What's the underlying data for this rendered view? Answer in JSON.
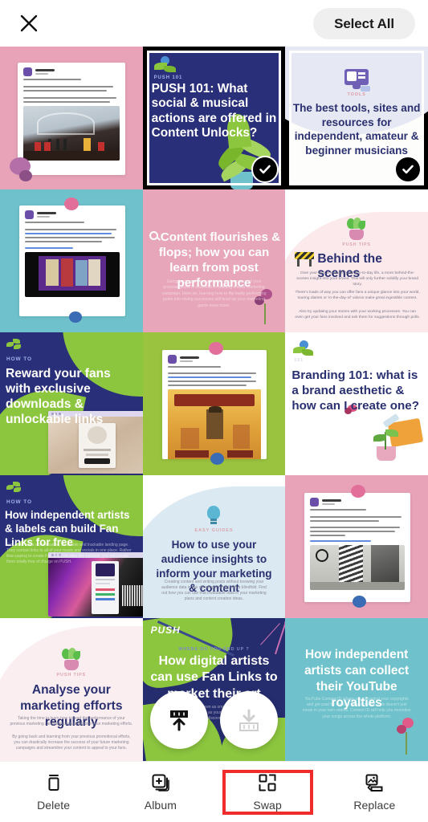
{
  "header": {
    "close_icon": "close-icon",
    "select_all_label": "Select All"
  },
  "grid": {
    "rows": 5,
    "cols": 3,
    "tiles": [
      {
        "id": "tile-1-1",
        "kind": "screenshot-post",
        "bg": "#e8a3b8",
        "selected": false,
        "post_caption": "Creative marketing idea #10",
        "post_body": "Not sure where to put on your next event on? In Beefeater gin's case, the sky's the limit - literally.",
        "post_body2": "When looking for venues, try approaching art galleries, theatres & others to make your event stand out."
      },
      {
        "id": "tile-1-2",
        "kind": "headline-card",
        "bg": "#2a2f7a",
        "selected": true,
        "eyebrow": "PUSH 101",
        "headline": "PUSH 101: What social & musical actions are offered in Content Unlocks?",
        "text_color": "#ffffff",
        "icon": "plant-sprout-icon"
      },
      {
        "id": "tile-1-3",
        "kind": "headline-card",
        "bg": "#fdfdfb",
        "selected": true,
        "eyebrow": "TOOLS",
        "headline": "The best tools, sites and resources for independent, amateur & beginner musicians",
        "text_color": "#2a3070",
        "icon": "monitor-icon"
      },
      {
        "id": "tile-2-1",
        "kind": "screenshot-post",
        "bg": "#6fc2cb",
        "selected": false,
        "post_caption": "Creative marketing idea #12",
        "post_body": "Support your fellow suppliers, brands & shops, just like @Cadbury UK have done in their 'For the love of chocolate' campaign, encouraging their customers to support their local shops as lockdowns lift.",
        "post_body2": "#forthelovechocolate"
      },
      {
        "id": "tile-2-2",
        "kind": "headline-card",
        "bg": "#e8a6bb",
        "selected": false,
        "eyebrow": "",
        "headline": "Content flourishes & flops; how you can learn from post performance",
        "body": "Going back and evaluating the performance of your previous posts is essential to building a solid marketing campaign. Here on, learning how to flip badly performing posts into raving successes will level up your marketing game even more.",
        "text_color": "#ffffff",
        "icon": "magnifier-icon"
      },
      {
        "id": "tile-2-3",
        "kind": "headline-card",
        "bg": "#fbeef0",
        "selected": false,
        "eyebrow": "PUSH TIPS",
        "headline": "Behind the scenes",
        "body": "Give your fans a look into your day-to-day life, a more behind-the-scenes insight into your brand. This will only further solidify your brand story.",
        "body2": "There's loads of way you can offer fans a unique glance into your world, touring diaries or 'in-the-day-of' videos make great ingestible content.",
        "body3": "Also try updating your stories with your working processes. You can even get your fans involved and ask them for suggestions through polls.",
        "text_color": "#2a3070",
        "icon": "potted-plant-icon"
      },
      {
        "id": "tile-3-1",
        "kind": "headline-card",
        "bg": "#2a2f7a",
        "selected": false,
        "eyebrow": "HOW TO",
        "headline": "Reward your fans with exclusive downloads & unlockable links",
        "text_color": "#ffffff",
        "icon": "leaves-icon"
      },
      {
        "id": "tile-3-2",
        "kind": "screenshot-post",
        "bg": "#9ac43f",
        "selected": false,
        "post_caption": "Creative marketing idea #7",
        "post_body": "Has your recently filled your brand's content a little dry? Look at other brands & add some ingenuity.",
        "post_body2": "How they are a calm, honest product, something both eye-catching and informative content in their customers.",
        "poster_title": "PRIOR BOYS"
      },
      {
        "id": "tile-3-3",
        "kind": "headline-card",
        "bg": "#ffffff",
        "selected": false,
        "eyebrow": "101",
        "headline": "Branding 101: what is a brand aesthetic & how can I create one?",
        "text_color": "#2a3070",
        "icon": "flower-icon"
      },
      {
        "id": "tile-4-1",
        "kind": "headline-card",
        "bg": "#2a2f7a",
        "selected": false,
        "eyebrow": "HOW TO",
        "headline": "How independent artists & labels can build Fan Links for free",
        "body": "Fan Links are a customisable, shareable and trackable landing page. They contain links to all of your music and socials in one place. Rather than paying to create Fan Links on sites like Linktree, you can create them totally free of charge on PUSH.",
        "text_color": "#ffffff",
        "icon": "leaves-icon"
      },
      {
        "id": "tile-4-2",
        "kind": "headline-card",
        "bg": "#f4f9fb",
        "selected": false,
        "eyebrow": "EASY GUIDES",
        "headline": "How to use your audience insights to inform your marketing & content",
        "body": "Creating content and writing posts without knowing your audience data is like shooting a target with a blindfold. Find out how you can use that invaluable data in your marketing plans and content creation ideas.",
        "text_color": "#2a3070",
        "icon": "lightbulb-icon"
      },
      {
        "id": "tile-4-3",
        "kind": "screenshot-post",
        "bg": "#e8a3b8",
        "selected": false,
        "post_caption": "Creative marketing idea #10",
        "post_body": "Volkswagen's campaign 'The Fun Theory' saw a set of stairs turned into a giant piano.",
        "post_body2": "Try and add a touch of fun to your marketing campaigns - it's guaranteed to get a smile from your audience.",
        "post_body3": "#marketing #pianostairs #thefuntheory"
      },
      {
        "id": "tile-5-1",
        "kind": "headline-card",
        "bg": "#ffffff",
        "selected": false,
        "eyebrow": "PUSH TIPS",
        "headline": "Analyse your marketing efforts regularly",
        "body": "Taking the time to learn how to read the performance of your previous marketing campaigns can streamline your marketing efforts.",
        "body2": "By going back and learning from your previous promotional efforts, you can drastically increase the success of your future marketing campaigns and streamline your content to appeal to your fans.",
        "text_color": "#2a3070",
        "icon": "potted-plant-icon"
      },
      {
        "id": "tile-5-2",
        "kind": "headline-card",
        "bg": "#262d6e",
        "selected": false,
        "eyebrow": "PUSH",
        "subeyebrow": "WHERE DO YOU END UP ?",
        "headline": "How digital artists can use Fan Links to market their art",
        "body": "Fan Links are also known as smart links that contain links to your art. Use them as your hub, a perfect place for fans to discover your art.",
        "text_color": "#ffffff",
        "icon": "leaves-icon"
      },
      {
        "id": "tile-5-3",
        "kind": "headline-card",
        "bg": "#6fc2cb",
        "selected": false,
        "eyebrow": "",
        "headline": "How independent artists can collect their YouTube royalties",
        "body": "YouTube Content ID allows you to control your copyrights and get paid for the use of your music. This doesn't just mean in your own videos. Content ID will help you monetise your songs across the whole platform.",
        "text_color": "#ffffff",
        "icon": "flower-icon"
      }
    ]
  },
  "floating_actions": [
    {
      "id": "fab-swap-src",
      "icon": "swap-up-icon",
      "state": "active"
    },
    {
      "id": "fab-swap-dst",
      "icon": "swap-down-icon",
      "state": "inactive"
    }
  ],
  "toolbar": {
    "items": [
      {
        "id": "tool-delete",
        "label": "Delete",
        "icon": "trash-icon",
        "selected": false
      },
      {
        "id": "tool-album",
        "label": "Album",
        "icon": "album-plus-icon",
        "selected": false
      },
      {
        "id": "tool-swap",
        "label": "Swap",
        "icon": "swap-icon",
        "selected": true
      },
      {
        "id": "tool-replace",
        "label": "Replace",
        "icon": "replace-image-icon",
        "selected": false
      }
    ],
    "highlight_color": "#ef2b2b"
  }
}
